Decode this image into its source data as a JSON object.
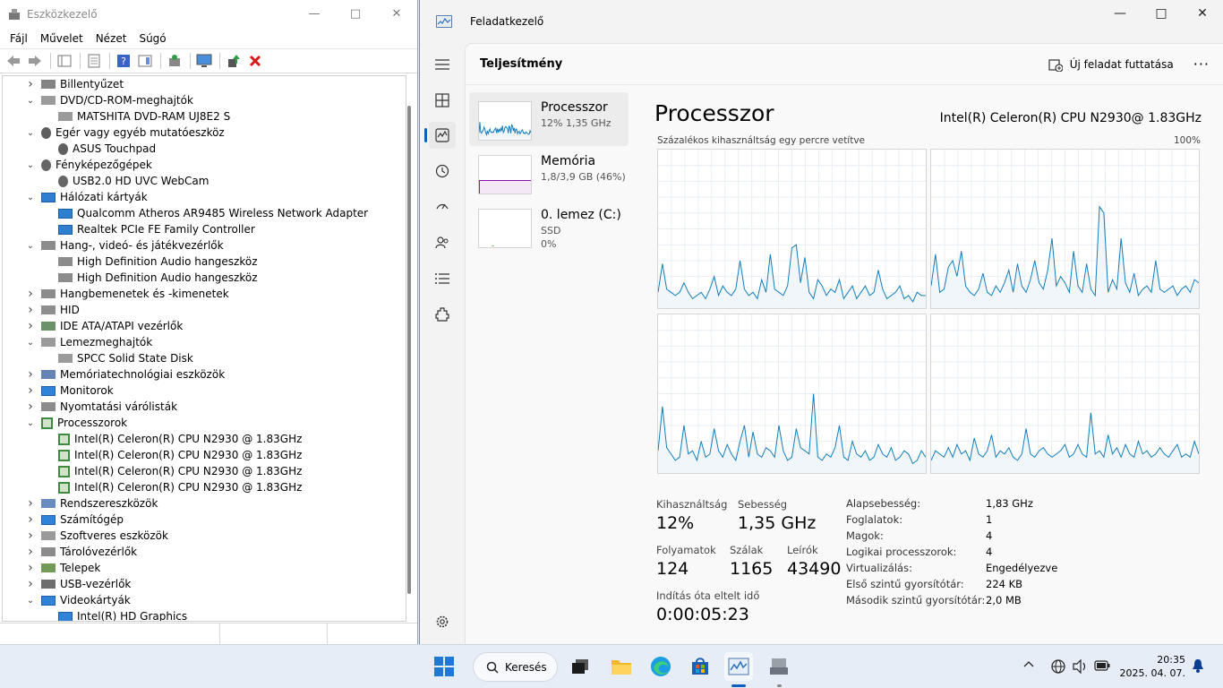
{
  "device_manager": {
    "title": "Eszközkezelő",
    "menu": [
      "Fájl",
      "Művelet",
      "Nézet",
      "Súgó"
    ],
    "tree": [
      {
        "label": "Billentyűzet",
        "expanded": false,
        "icon": "keyboard-icon"
      },
      {
        "label": "DVD/CD-ROM-meghajtók",
        "expanded": true,
        "icon": "dvd-drive-icon"
      },
      {
        "label": "MATSHITA DVD-RAM UJ8E2 S",
        "child": true,
        "icon": "dvd-drive-icon"
      },
      {
        "label": "Egér vagy egyéb mutatóeszköz",
        "expanded": true,
        "icon": "mouse-icon"
      },
      {
        "label": "ASUS Touchpad",
        "child": true,
        "icon": "mouse-icon"
      },
      {
        "label": "Fényképezőgépek",
        "expanded": true,
        "icon": "camera-icon"
      },
      {
        "label": "USB2.0 HD UVC WebCam",
        "child": true,
        "icon": "camera-icon"
      },
      {
        "label": "Hálózati kártyák",
        "expanded": true,
        "icon": "network-adapter-icon"
      },
      {
        "label": "Qualcomm Atheros AR9485 Wireless Network Adapter",
        "child": true,
        "icon": "network-adapter-icon"
      },
      {
        "label": "Realtek PCIe FE Family Controller",
        "child": true,
        "icon": "network-adapter-icon"
      },
      {
        "label": "Hang-, videó- és játékvezérlők",
        "expanded": true,
        "icon": "speaker-icon"
      },
      {
        "label": "High Definition Audio hangeszköz",
        "child": true,
        "icon": "speaker-icon"
      },
      {
        "label": "High Definition Audio hangeszköz",
        "child": true,
        "icon": "speaker-icon"
      },
      {
        "label": "Hangbemenetek és -kimenetek",
        "expanded": false,
        "icon": "speaker-icon"
      },
      {
        "label": "HID",
        "expanded": false,
        "icon": "hid-icon"
      },
      {
        "label": "IDE ATA/ATAPI vezérlők",
        "expanded": false,
        "icon": "ide-controller-icon"
      },
      {
        "label": "Lemezmeghajtók",
        "expanded": true,
        "icon": "disk-drive-icon"
      },
      {
        "label": "SPCC Solid State Disk",
        "child": true,
        "icon": "disk-drive-icon"
      },
      {
        "label": "Memóriatechnológiai eszközök",
        "expanded": false,
        "icon": "memory-device-icon"
      },
      {
        "label": "Monitorok",
        "expanded": false,
        "icon": "monitor-icon"
      },
      {
        "label": "Nyomtatási várólisták",
        "expanded": false,
        "icon": "print-queue-icon"
      },
      {
        "label": "Processzorok",
        "expanded": true,
        "icon": "processor-icon"
      },
      {
        "label": "Intel(R) Celeron(R) CPU  N2930  @ 1.83GHz",
        "child": true,
        "icon": "processor-icon"
      },
      {
        "label": "Intel(R) Celeron(R) CPU  N2930  @ 1.83GHz",
        "child": true,
        "icon": "processor-icon"
      },
      {
        "label": "Intel(R) Celeron(R) CPU  N2930  @ 1.83GHz",
        "child": true,
        "icon": "processor-icon"
      },
      {
        "label": "Intel(R) Celeron(R) CPU  N2930  @ 1.83GHz",
        "child": true,
        "icon": "processor-icon"
      },
      {
        "label": "Rendszereszközök",
        "expanded": false,
        "icon": "system-device-icon"
      },
      {
        "label": "Számítógép",
        "expanded": false,
        "icon": "computer-icon"
      },
      {
        "label": "Szoftveres eszközök",
        "expanded": false,
        "icon": "software-device-icon"
      },
      {
        "label": "Tárolóvezérlők",
        "expanded": false,
        "icon": "storage-controller-icon"
      },
      {
        "label": "Telepek",
        "expanded": false,
        "icon": "battery-icon"
      },
      {
        "label": "USB-vezérlők",
        "expanded": false,
        "icon": "usb-icon"
      },
      {
        "label": "Videokártyák",
        "expanded": true,
        "icon": "display-adapter-icon"
      },
      {
        "label": "Intel(R) HD Graphics",
        "child": true,
        "icon": "display-adapter-icon"
      }
    ]
  },
  "task_manager": {
    "title": "Feladatkezelő",
    "page_title": "Teljesítmény",
    "run_task_label": "Új feladat futtatása",
    "more": "···",
    "resources": [
      {
        "name": "Processzor",
        "sub1": "12%  1,35 GHz",
        "sub2": ""
      },
      {
        "name": "Memória",
        "sub1": "1,8/3,9 GB (46%)",
        "sub2": ""
      },
      {
        "name": "0. lemez (C:)",
        "sub1": "SSD",
        "sub2": "0%"
      }
    ],
    "memory_usage_fraction": 0.46,
    "cpu": {
      "title": "Processzor",
      "model": "Intel(R) Celeron(R) CPU N2930@ 1.83GHz",
      "graph_caption": "Százalékos kihasználtság egy percre vetítve",
      "graph_max": "100%",
      "stats": {
        "utilization_label": "Kihasználtság",
        "utilization": "12%",
        "speed_label": "Sebesség",
        "speed": "1,35 GHz",
        "processes_label": "Folyamatok",
        "processes": "124",
        "threads_label": "Szálak",
        "threads": "1165",
        "handles_label": "Leírók",
        "handles": "43490",
        "uptime_label": "Indítás óta eltelt idő",
        "uptime": "0:00:05:23"
      },
      "details": [
        {
          "label": "Alapsebesség:",
          "value": "1,83 GHz"
        },
        {
          "label": "Foglalatok:",
          "value": "1"
        },
        {
          "label": "Magok:",
          "value": "4"
        },
        {
          "label": "Logikai processzorok:",
          "value": "4"
        },
        {
          "label": "Virtualizálás:",
          "value": "Engedélyezve"
        },
        {
          "label": "Első szintű gyorsítótár:",
          "value": "224 KB"
        },
        {
          "label": "Második szintű gyorsítótár:",
          "value": "2,0 MB"
        }
      ],
      "core_graphs": [
        [
          10,
          28,
          12,
          10,
          8,
          10,
          16,
          10,
          6,
          8,
          10,
          6,
          12,
          20,
          8,
          14,
          10,
          8,
          12,
          30,
          12,
          8,
          10,
          6,
          18,
          10,
          34,
          12,
          10,
          8,
          14,
          38,
          40,
          16,
          32,
          10,
          6,
          18,
          14,
          8,
          12,
          10,
          18,
          6,
          10,
          14,
          6,
          10,
          14,
          8,
          10,
          24,
          12,
          6,
          8,
          10,
          14,
          6,
          8,
          4,
          10,
          8,
          8
        ],
        [
          14,
          34,
          10,
          12,
          26,
          30,
          20,
          36,
          14,
          10,
          8,
          12,
          22,
          10,
          8,
          14,
          10,
          16,
          24,
          10,
          28,
          14,
          10,
          18,
          30,
          16,
          12,
          24,
          44,
          14,
          20,
          16,
          10,
          36,
          14,
          10,
          28,
          12,
          8,
          64,
          60,
          10,
          18,
          12,
          44,
          16,
          10,
          22,
          8,
          12,
          14,
          10,
          30,
          12,
          10,
          12,
          14,
          8,
          12,
          14,
          10,
          18,
          16
        ],
        [
          14,
          42,
          16,
          12,
          8,
          10,
          30,
          12,
          14,
          8,
          20,
          10,
          12,
          28,
          14,
          10,
          18,
          12,
          8,
          20,
          30,
          10,
          26,
          12,
          10,
          16,
          14,
          10,
          30,
          14,
          8,
          10,
          28,
          16,
          14,
          12,
          50,
          10,
          8,
          12,
          10,
          16,
          30,
          10,
          8,
          20,
          12,
          10,
          14,
          8,
          10,
          18,
          12,
          10,
          16,
          8,
          10,
          14,
          12,
          6,
          8,
          14,
          10
        ],
        [
          8,
          14,
          12,
          10,
          16,
          10,
          18,
          12,
          14,
          8,
          22,
          12,
          10,
          14,
          24,
          10,
          14,
          12,
          16,
          10,
          8,
          12,
          28,
          12,
          10,
          14,
          16,
          12,
          10,
          12,
          14,
          18,
          10,
          12,
          18,
          12,
          10,
          38,
          12,
          14,
          10,
          24,
          12,
          16,
          10,
          18,
          12,
          10,
          20,
          12,
          14,
          10,
          12,
          16,
          12,
          10,
          14,
          18,
          10,
          12,
          10,
          20,
          12
        ]
      ]
    },
    "accent_color": "#117dbb",
    "memory_color": "#8b12ae"
  },
  "taskbar": {
    "search_label": "Keresés",
    "apps": [
      "start-icon",
      "task-view-icon",
      "file-explorer-icon",
      "edge-icon",
      "store-icon",
      "task-manager-icon",
      "device-manager-icon"
    ],
    "time": "20:35",
    "date": "2025. 04. 07."
  }
}
